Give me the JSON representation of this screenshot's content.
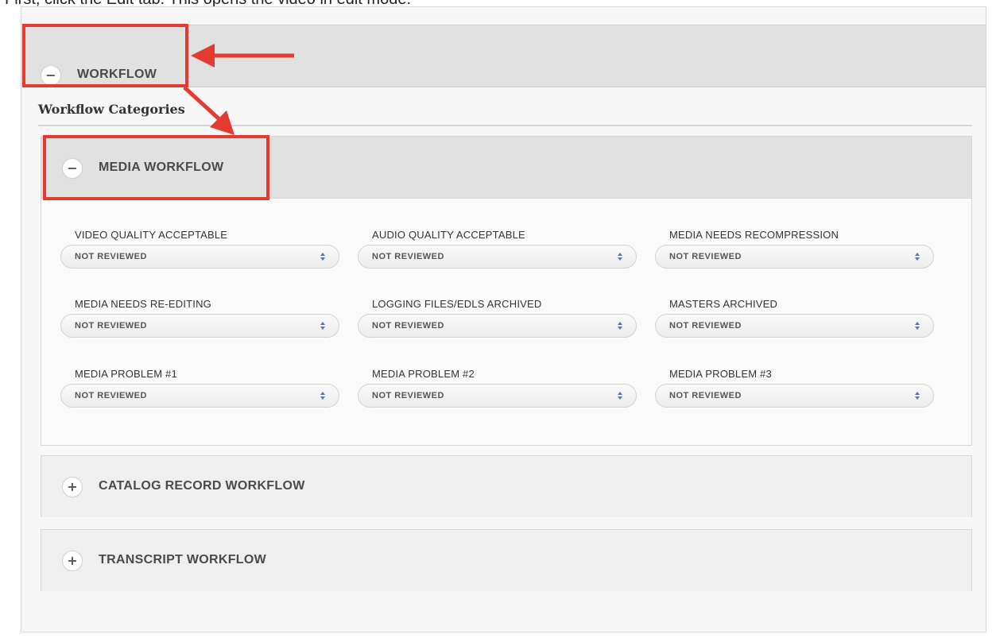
{
  "caption": "First, click the Edit tab. This opens the video in edit mode.",
  "workflow_header": {
    "label": "WORKFLOW",
    "toggle": "−"
  },
  "categories_title": "Workflow Categories",
  "media_workflow": {
    "label": "MEDIA WORKFLOW",
    "toggle": "−",
    "fields": [
      {
        "label": "VIDEO QUALITY ACCEPTABLE",
        "value": "NOT REVIEWED"
      },
      {
        "label": "AUDIO QUALITY ACCEPTABLE",
        "value": "NOT REVIEWED"
      },
      {
        "label": "MEDIA NEEDS RECOMPRESSION",
        "value": "NOT REVIEWED"
      },
      {
        "label": "MEDIA NEEDS RE-EDITING",
        "value": "NOT REVIEWED"
      },
      {
        "label": "LOGGING FILES/EDLS ARCHIVED",
        "value": "NOT REVIEWED"
      },
      {
        "label": "MASTERS ARCHIVED",
        "value": "NOT REVIEWED"
      },
      {
        "label": "MEDIA PROBLEM #1",
        "value": "NOT REVIEWED"
      },
      {
        "label": "MEDIA PROBLEM #2",
        "value": "NOT REVIEWED"
      },
      {
        "label": "MEDIA PROBLEM #3",
        "value": "NOT REVIEWED"
      }
    ]
  },
  "catalog_workflow": {
    "label": "CATALOG RECORD WORKFLOW",
    "toggle": "+"
  },
  "transcript_workflow": {
    "label": "TRANSCRIPT WORKFLOW",
    "toggle": "+"
  },
  "colors": {
    "annotation": "#e53a2f",
    "select_arrow": "#5a6fc8"
  },
  "icons": {
    "collapse": "minus-icon",
    "expand": "plus-icon",
    "select": "up-down-arrows-icon"
  }
}
